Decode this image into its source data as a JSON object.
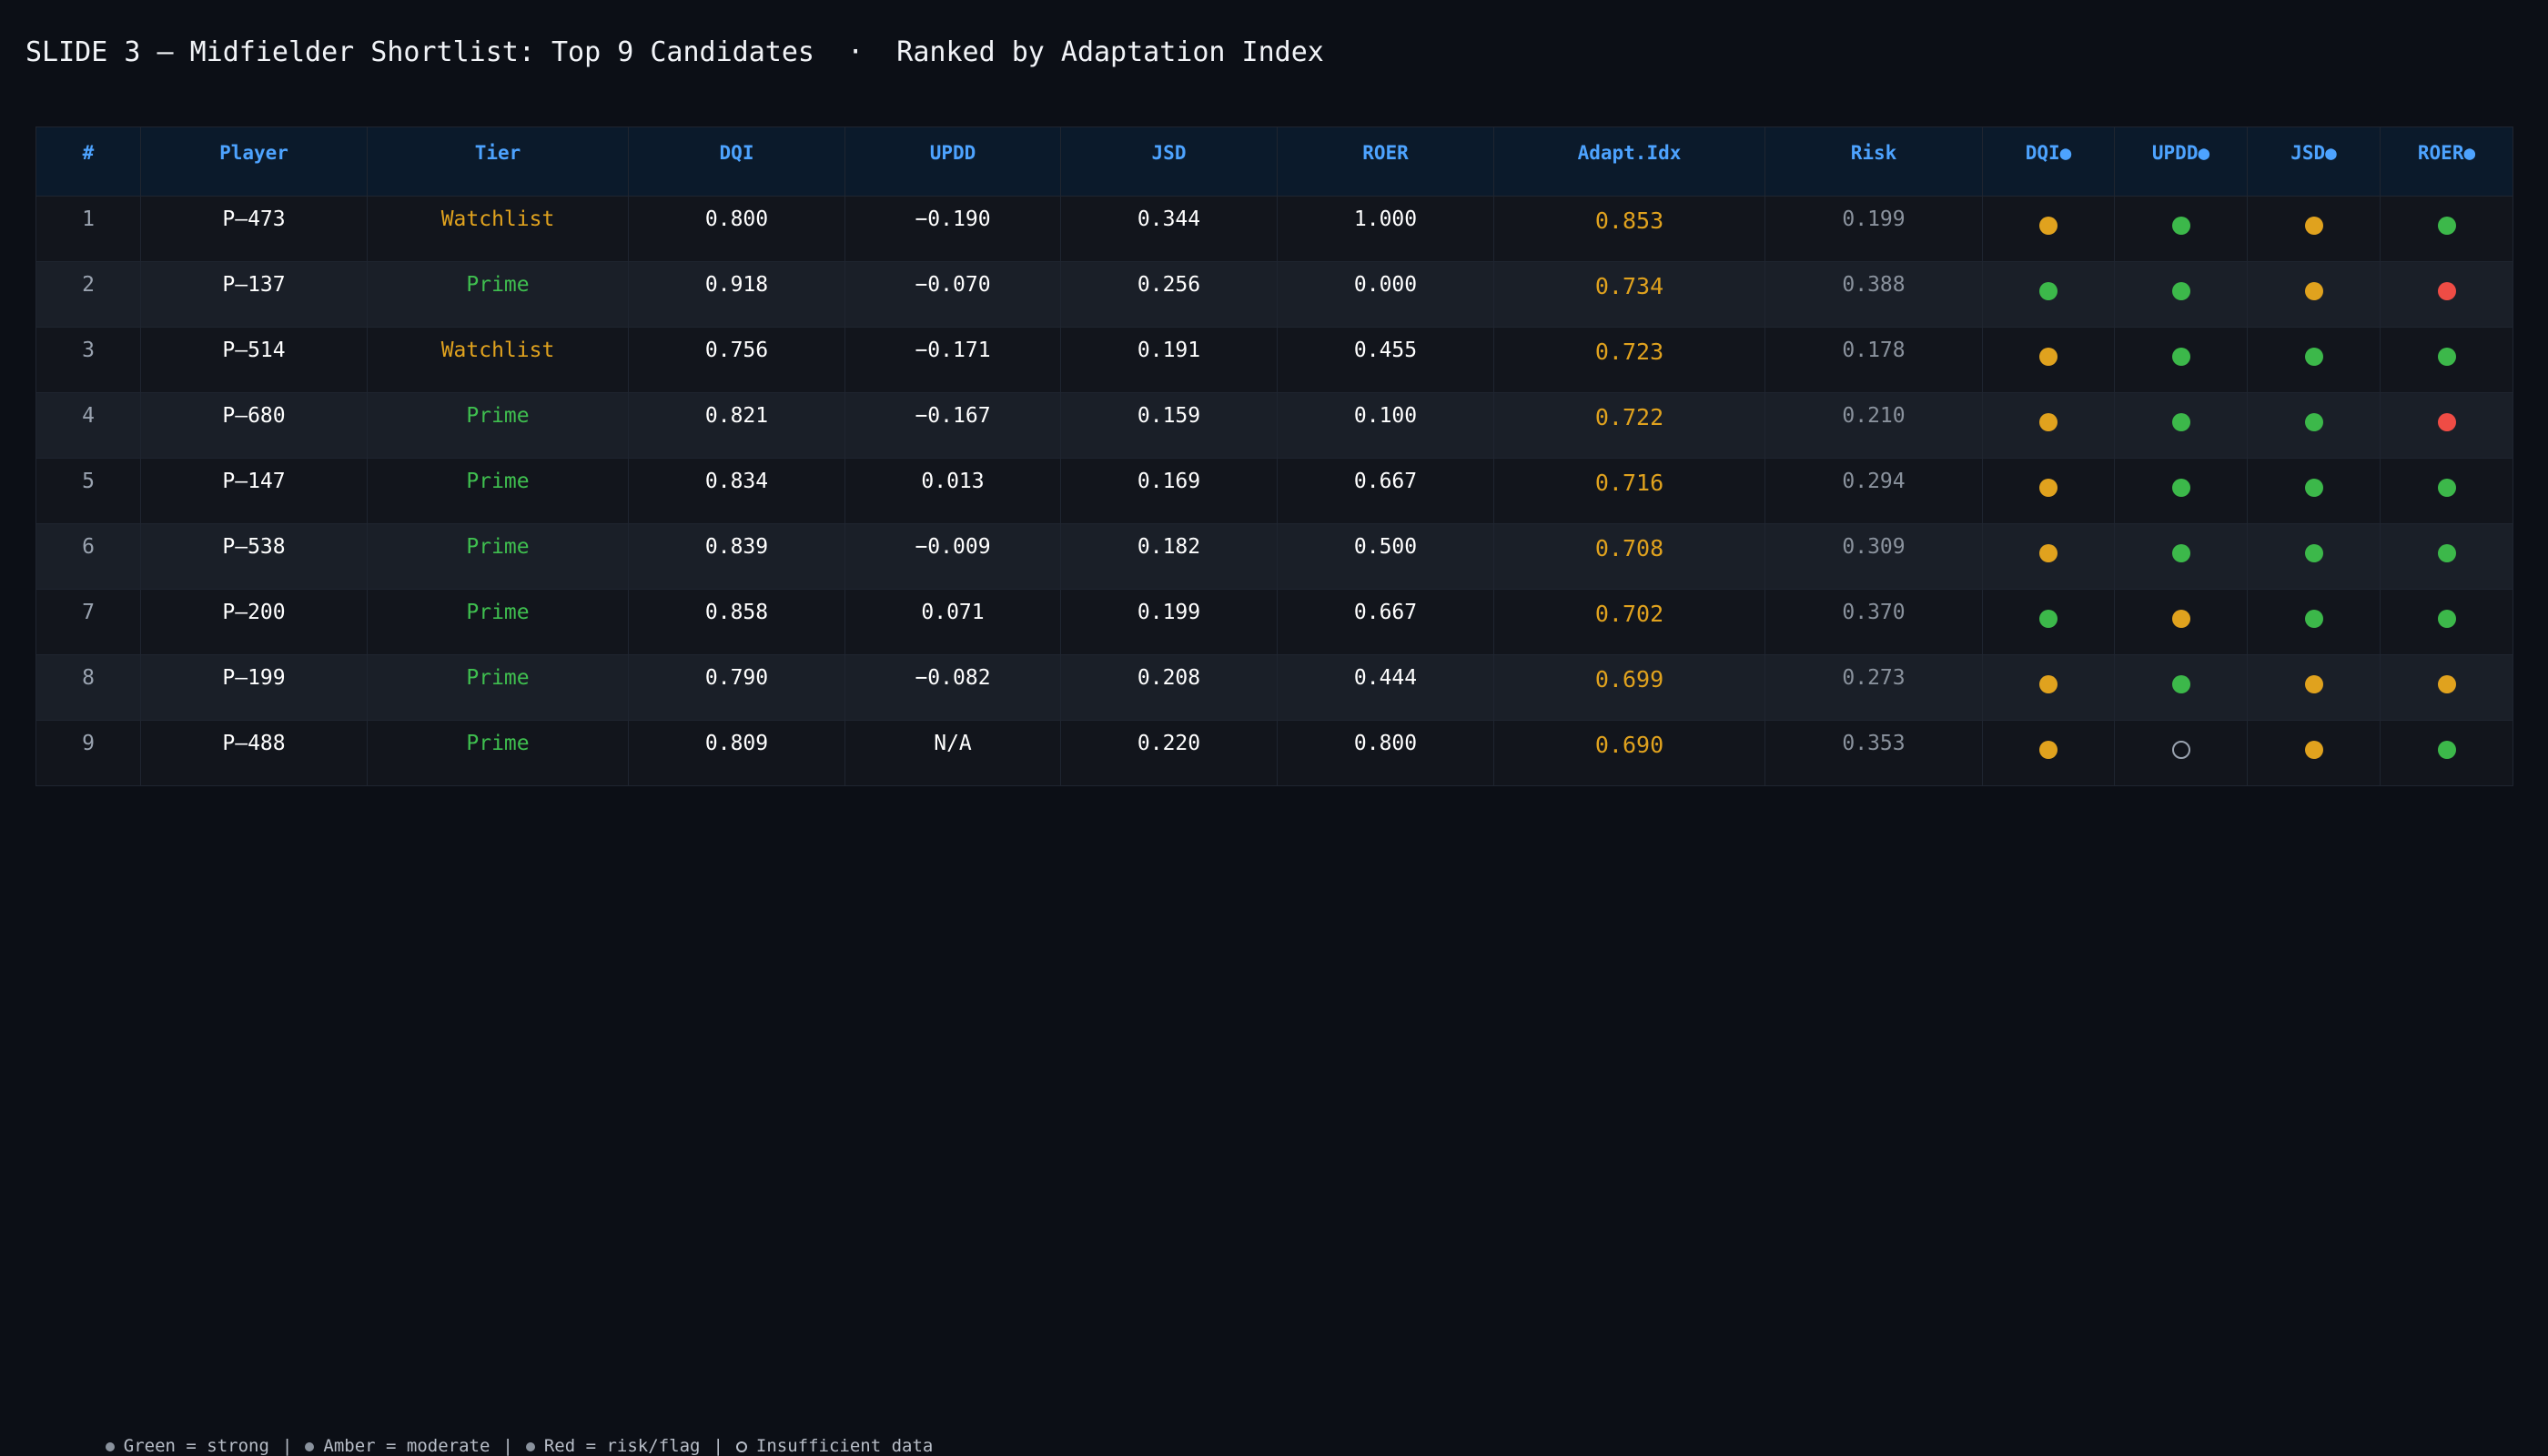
{
  "slide": {
    "title": "SLIDE 3 — Midfielder Shortlist: Top 9 Candidates  ·  Ranked by Adaptation Index"
  },
  "colors": {
    "background": "#0c0f16",
    "header_text": "#4da3ff",
    "green": "#3cb84a",
    "amber": "#e0a21e",
    "red": "#ef4c45"
  },
  "table": {
    "headers": [
      "#",
      "Player",
      "Tier",
      "DQI",
      "UPDD",
      "JSD",
      "ROER",
      "Adapt.Idx",
      "Risk",
      "DQI●",
      "UPDD●",
      "JSD●",
      "ROER●"
    ],
    "rows": [
      {
        "rank": "1",
        "player": "P–473",
        "tier": "Watchlist",
        "dqi": "0.800",
        "updd": "−0.190",
        "jsd": "0.344",
        "roer": "1.000",
        "adapt": "0.853",
        "risk": "0.199",
        "dots": [
          "amber",
          "green",
          "amber",
          "green"
        ]
      },
      {
        "rank": "2",
        "player": "P–137",
        "tier": "Prime",
        "dqi": "0.918",
        "updd": "−0.070",
        "jsd": "0.256",
        "roer": "0.000",
        "adapt": "0.734",
        "risk": "0.388",
        "dots": [
          "green",
          "green",
          "amber",
          "red"
        ]
      },
      {
        "rank": "3",
        "player": "P–514",
        "tier": "Watchlist",
        "dqi": "0.756",
        "updd": "−0.171",
        "jsd": "0.191",
        "roer": "0.455",
        "adapt": "0.723",
        "risk": "0.178",
        "dots": [
          "amber",
          "green",
          "green",
          "green"
        ]
      },
      {
        "rank": "4",
        "player": "P–680",
        "tier": "Prime",
        "dqi": "0.821",
        "updd": "−0.167",
        "jsd": "0.159",
        "roer": "0.100",
        "adapt": "0.722",
        "risk": "0.210",
        "dots": [
          "amber",
          "green",
          "green",
          "red"
        ]
      },
      {
        "rank": "5",
        "player": "P–147",
        "tier": "Prime",
        "dqi": "0.834",
        "updd": "0.013",
        "jsd": "0.169",
        "roer": "0.667",
        "adapt": "0.716",
        "risk": "0.294",
        "dots": [
          "amber",
          "green",
          "green",
          "green"
        ]
      },
      {
        "rank": "6",
        "player": "P–538",
        "tier": "Prime",
        "dqi": "0.839",
        "updd": "−0.009",
        "jsd": "0.182",
        "roer": "0.500",
        "adapt": "0.708",
        "risk": "0.309",
        "dots": [
          "amber",
          "green",
          "green",
          "green"
        ]
      },
      {
        "rank": "7",
        "player": "P–200",
        "tier": "Prime",
        "dqi": "0.858",
        "updd": "0.071",
        "jsd": "0.199",
        "roer": "0.667",
        "adapt": "0.702",
        "risk": "0.370",
        "dots": [
          "green",
          "amber",
          "green",
          "green"
        ]
      },
      {
        "rank": "8",
        "player": "P–199",
        "tier": "Prime",
        "dqi": "0.790",
        "updd": "−0.082",
        "jsd": "0.208",
        "roer": "0.444",
        "adapt": "0.699",
        "risk": "0.273",
        "dots": [
          "amber",
          "green",
          "amber",
          "amber"
        ]
      },
      {
        "rank": "9",
        "player": "P–488",
        "tier": "Prime",
        "dqi": "0.809",
        "updd": "N/A",
        "jsd": "0.220",
        "roer": "0.800",
        "adapt": "0.690",
        "risk": "0.353",
        "dots": [
          "amber",
          "empty",
          "amber",
          "green"
        ]
      }
    ]
  },
  "legend": {
    "green": "Green = strong",
    "amber": "Amber = moderate",
    "red": "Red = risk/flag",
    "empty": "Insufficient data",
    "separator": "|"
  }
}
